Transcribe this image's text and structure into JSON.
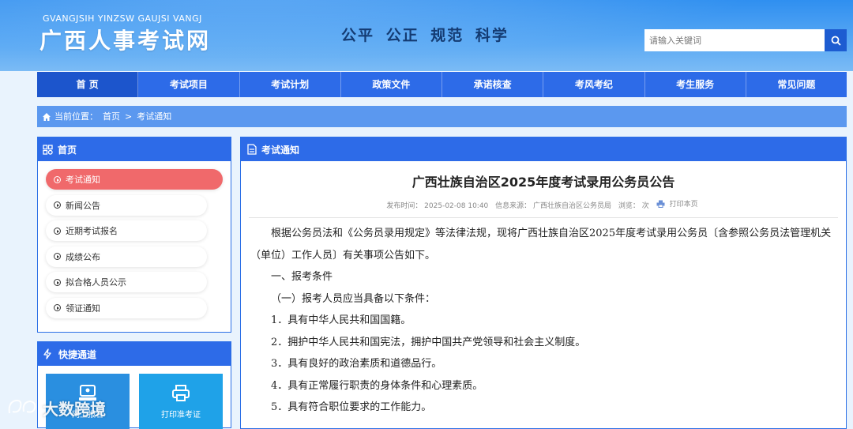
{
  "header": {
    "brand_en": "GVANGJSIH YINZSW GAUJSI VANGJ",
    "brand_cn": "广西人事考试网",
    "slogan": "公平  公正  规范  科学",
    "search_placeholder": "请输入关键词"
  },
  "nav": [
    "首 页",
    "考试项目",
    "考试计划",
    "政策文件",
    "承诺核查",
    "考风考纪",
    "考生服务",
    "常见问题"
  ],
  "breadcrumb": {
    "label": "当前位置：",
    "home": "首页",
    "sep": ">",
    "current": "考试通知"
  },
  "sidebar": {
    "title": "首页",
    "items": [
      "考试通知",
      "新闻公告",
      "近期考试报名",
      "成绩公布",
      "拟合格人员公示",
      "领证通知"
    ]
  },
  "quick": {
    "title": "快捷通道",
    "buttons": [
      "网上报名",
      "打印准考证"
    ]
  },
  "article": {
    "section": "考试通知",
    "title": "广西壮族自治区2025年度考试录用公务员公告",
    "meta_time": "发布时间：  2025-02-08 10:40",
    "meta_source": "信息来源：  广西壮族自治区公务员局",
    "meta_views": "浏览：    次",
    "print": "打印本页",
    "paragraphs": [
      "根据公务员法和《公务员录用规定》等法律法规，现将广西壮族自治区2025年度考试录用公务员〔含参照公务员法管理机关（单位）工作人员〕有关事项公告如下。",
      "一、报考条件",
      "（一）报考人员应当具备以下条件：",
      "1．具有中华人民共和国国籍。",
      "2．拥护中华人民共和国宪法，拥护中国共产党领导和社会主义制度。",
      "3．具有良好的政治素质和道德品行。",
      "4．具有正常履行职责的身体条件和心理素质。",
      "5．具有符合职位要求的工作能力。"
    ]
  },
  "watermark": "大数跨境",
  "colors": {
    "nav": "#2d6be8",
    "accent": "#f0696b",
    "breadcrumb": "#5b98ef"
  }
}
